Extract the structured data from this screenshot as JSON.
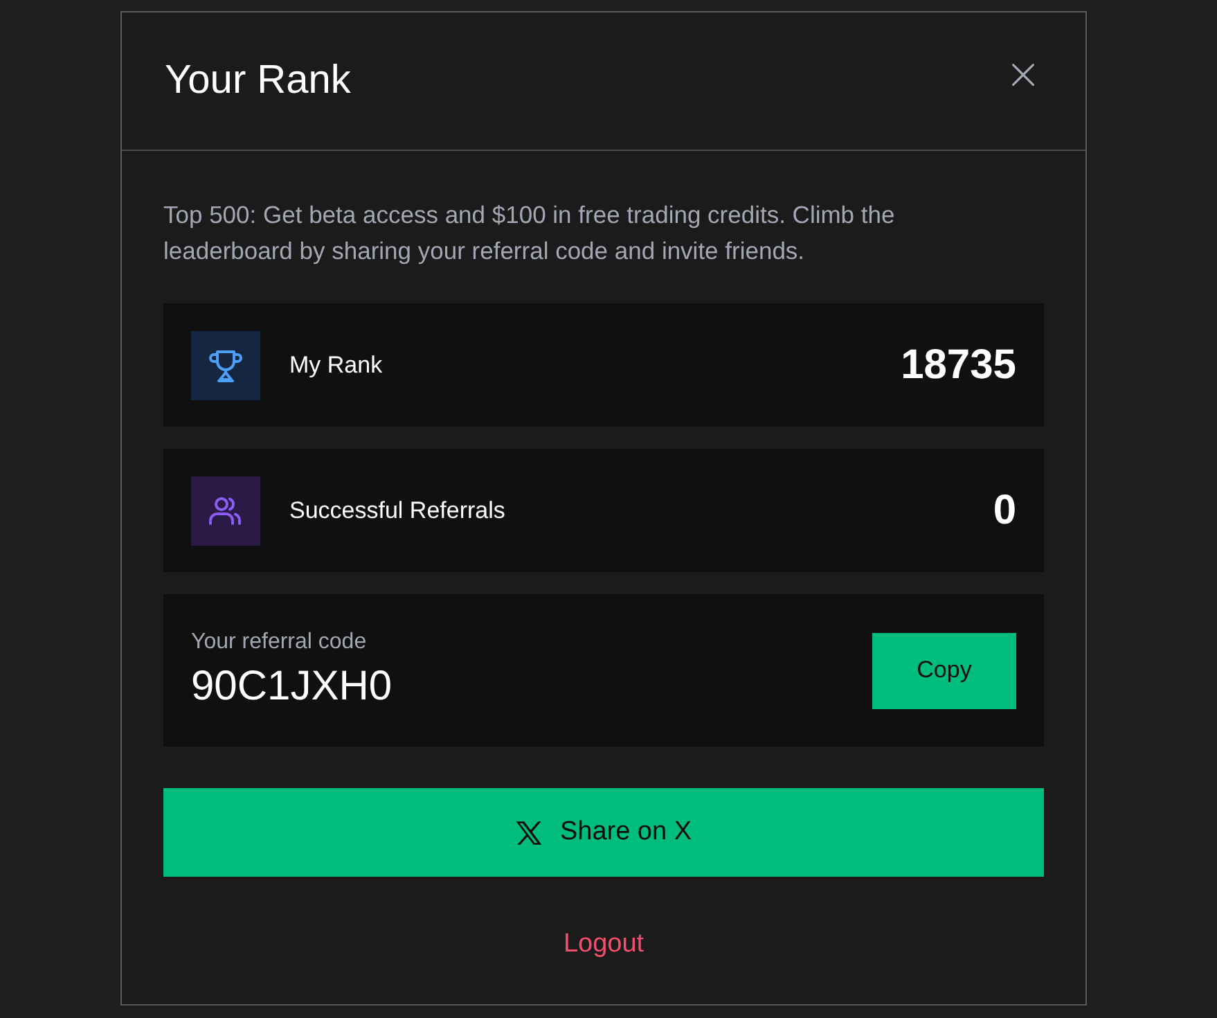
{
  "dialog": {
    "title": "Your Rank",
    "description": "Top 500: Get beta access and $100 in free trading credits. Climb the leaderboard by sharing your referral code and invite friends."
  },
  "stats": [
    {
      "kind": "trophy",
      "label": "My Rank",
      "value": "18735"
    },
    {
      "kind": "people",
      "label": "Successful Referrals",
      "value": "0"
    }
  ],
  "referral": {
    "label": "Your referral code",
    "code": "90C1JXH0",
    "button": "Copy"
  },
  "share_button": "Share on X",
  "logout": "Logout"
}
